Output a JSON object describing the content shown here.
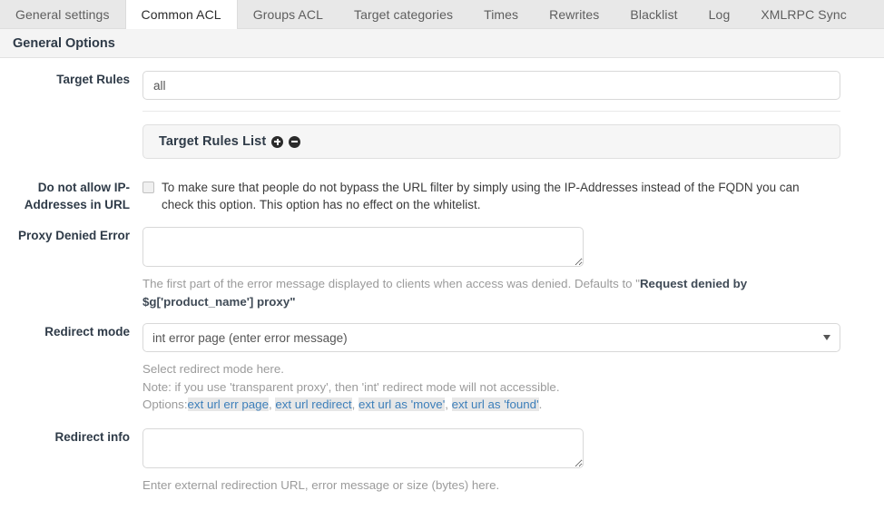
{
  "tabs": [
    {
      "label": "General settings",
      "active": false
    },
    {
      "label": "Common ACL",
      "active": true
    },
    {
      "label": "Groups ACL",
      "active": false
    },
    {
      "label": "Target categories",
      "active": false
    },
    {
      "label": "Times",
      "active": false
    },
    {
      "label": "Rewrites",
      "active": false
    },
    {
      "label": "Blacklist",
      "active": false
    },
    {
      "label": "Log",
      "active": false
    },
    {
      "label": "XMLRPC Sync",
      "active": false
    }
  ],
  "section": {
    "title": "General Options"
  },
  "fields": {
    "target_rules": {
      "label": "Target Rules",
      "value": "all",
      "placeholder": ""
    },
    "target_rules_list": {
      "title": "Target Rules List",
      "add_icon": "plus-circle-icon",
      "remove_icon": "minus-circle-icon"
    },
    "deny_ip": {
      "label": "Do not allow IP-Addresses in URL",
      "checkbox_text": "To make sure that people do not bypass the URL filter by simply using the IP-Addresses instead of the FQDN you can check this option. This option has no effect on the whitelist.",
      "checked": false
    },
    "proxy_denied_error": {
      "label": "Proxy Denied Error",
      "value": "",
      "help_prefix": "The first part of the error message displayed to clients when access was denied. Defaults to \"",
      "help_bold": "Request denied by $g['product_name'] proxy",
      "help_suffix": "\""
    },
    "redirect_mode": {
      "label": "Redirect mode",
      "selected": "int error page (enter error message)",
      "options": [
        "int error page (enter error message)",
        "ext url err page",
        "ext url redirect",
        "ext url as 'move'",
        "ext url as 'found'"
      ],
      "help_line1": "Select redirect mode here.",
      "help_line2": "Note: if you use 'transparent proxy', then 'int' redirect mode will not accessible.",
      "help_line3_prefix": "Options:",
      "help_links": [
        "ext url err page",
        "ext url redirect",
        "ext url as 'move'",
        "ext url as 'found'"
      ],
      "help_line3_suffix": "."
    },
    "redirect_info": {
      "label": "Redirect info",
      "value": "",
      "help": "Enter external redirection URL, error message or size (bytes) here."
    }
  },
  "colors": {
    "tab_active_bg": "#ffffff",
    "tab_bar_bg": "#e8e8e8",
    "section_bg": "#f4f4f4",
    "link": "#3d7fba",
    "link_highlight": "#e7e7e7",
    "label": "#2f3b48",
    "help": "#9b9b9b"
  }
}
